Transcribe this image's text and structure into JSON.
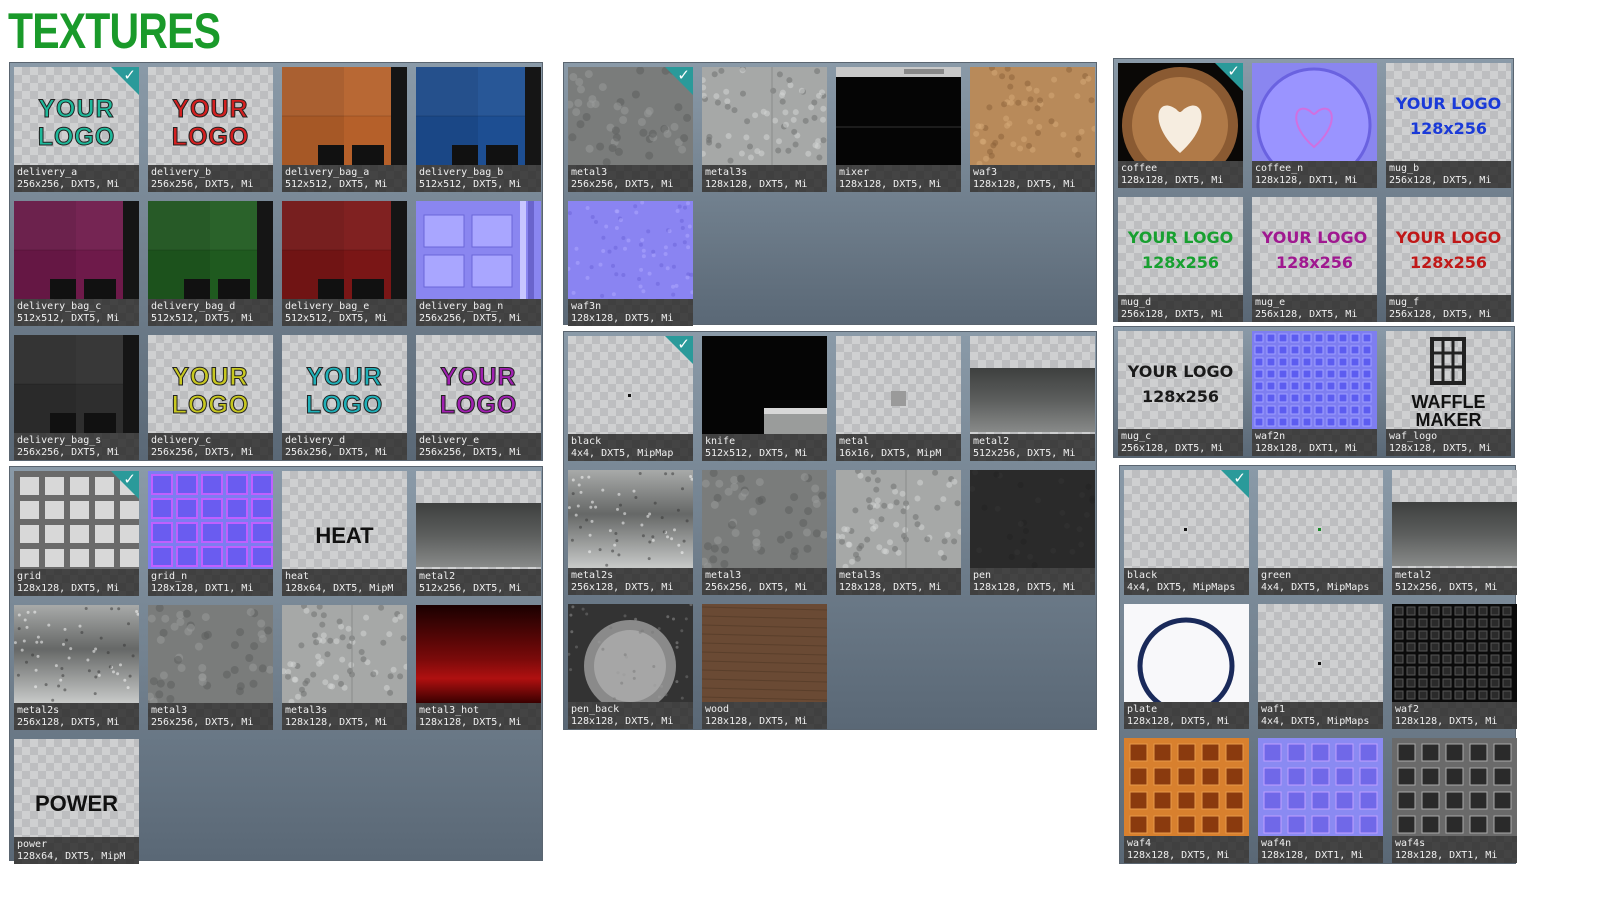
{
  "title": "TEXTURES",
  "logo_text": "YOUR LOGO",
  "logo_text_line1": "YOUR",
  "logo_text_line2": "LOGO",
  "logo_size_text": "128x256",
  "heat_text": "HEAT",
  "power_text": "POWER",
  "waffle_maker_text": "WAFFLE MAKER",
  "colors": {
    "title": "#1a9a2a",
    "selection": "#2a9a9a"
  },
  "panels": [
    {
      "id": "p1",
      "tiles": [
        {
          "name": "delivery_a",
          "info": "256x256, DXT5, Mi",
          "selected": true,
          "kind": "logo",
          "logo_color": "#1fb89a"
        },
        {
          "name": "delivery_b",
          "info": "256x256, DXT5, Mi",
          "kind": "logo",
          "logo_color": "#d42020"
        },
        {
          "name": "delivery_bag_a",
          "info": "512x512, DXT5, Mi",
          "kind": "bag",
          "color": "#b5602a"
        },
        {
          "name": "delivery_bag_b",
          "info": "512x512, DXT5, Mi",
          "kind": "bag",
          "color": "#1d4e92"
        },
        {
          "name": "delivery_bag_c",
          "info": "512x512, DXT5, Mi",
          "kind": "bag",
          "color": "#6e1a4a"
        },
        {
          "name": "delivery_bag_d",
          "info": "512x512, DXT5, Mi",
          "kind": "bag",
          "color": "#1f5a1f"
        },
        {
          "name": "delivery_bag_e",
          "info": "512x512, DXT5, Mi",
          "kind": "bag",
          "color": "#7a1616"
        },
        {
          "name": "delivery_bag_n",
          "info": "256x256, DXT5, Mi",
          "kind": "normal"
        },
        {
          "name": "delivery_bag_s",
          "info": "256x256, DXT5, Mi",
          "kind": "bag",
          "color": "#2e2e2e"
        },
        {
          "name": "delivery_c",
          "info": "256x256, DXT5, Mi",
          "kind": "logo",
          "logo_color": "#c8c820"
        },
        {
          "name": "delivery_d",
          "info": "256x256, DXT5, Mi",
          "kind": "logo",
          "logo_color": "#20b0b8"
        },
        {
          "name": "delivery_e",
          "info": "256x256, DXT5, Mi",
          "kind": "logo",
          "logo_color": "#a020b0"
        }
      ]
    },
    {
      "id": "p2",
      "tiles": [
        {
          "name": "grid",
          "info": "128x128, DXT5, Mi",
          "selected": true,
          "kind": "grid"
        },
        {
          "name": "grid_n",
          "info": "128x128, DXT1, Mi",
          "kind": "gridn"
        },
        {
          "name": "heat",
          "info": "128x64, DXT5, MipM",
          "kind": "heat"
        },
        {
          "name": "metal2",
          "info": "512x256, DXT5, Mi",
          "kind": "metal2"
        },
        {
          "name": "metal2s",
          "info": "256x128, DXT5, Mi",
          "kind": "metal2s"
        },
        {
          "name": "metal3",
          "info": "256x256, DXT5, Mi",
          "kind": "metal3"
        },
        {
          "name": "metal3s",
          "info": "128x128, DXT5, Mi",
          "kind": "metal3s"
        },
        {
          "name": "metal3_hot",
          "info": "128x128, DXT5, Mi",
          "kind": "hot"
        },
        {
          "name": "power",
          "info": "128x64, DXT5, MipM",
          "kind": "power"
        }
      ]
    },
    {
      "id": "p3",
      "tiles": [
        {
          "name": "metal3",
          "info": "256x256, DXT5, Mi",
          "selected": true,
          "kind": "metal3"
        },
        {
          "name": "metal3s",
          "info": "128x128, DXT5, Mi",
          "kind": "metal3s"
        },
        {
          "name": "mixer",
          "info": "128x128, DXT5, Mi",
          "kind": "mixer"
        },
        {
          "name": "waf3",
          "info": "128x128, DXT5, Mi",
          "kind": "sand"
        },
        {
          "name": "waf3n",
          "info": "128x128, DXT5, Mi",
          "kind": "bluenoise"
        }
      ]
    },
    {
      "id": "p4",
      "tiles": [
        {
          "name": "black",
          "info": "4x4, DXT5, MipMap",
          "selected": true,
          "kind": "dot"
        },
        {
          "name": "knife",
          "info": "512x512, DXT5, Mi",
          "kind": "knife"
        },
        {
          "name": "metal",
          "info": "16x16, DXT5, MipM",
          "kind": "square"
        },
        {
          "name": "metal2",
          "info": "512x256, DXT5, Mi",
          "kind": "metal2"
        },
        {
          "name": "metal2s",
          "info": "256x128, DXT5, Mi",
          "kind": "metal2s"
        },
        {
          "name": "metal3",
          "info": "256x256, DXT5, Mi",
          "kind": "metal3"
        },
        {
          "name": "metal3s",
          "info": "128x128, DXT5, Mi",
          "kind": "metal3s"
        },
        {
          "name": "pen",
          "info": "128x128, DXT5, Mi",
          "kind": "pen"
        },
        {
          "name": "pen_back",
          "info": "128x128, DXT5, Mi",
          "kind": "penback"
        },
        {
          "name": "wood",
          "info": "128x128, DXT5, Mi",
          "kind": "wood"
        }
      ]
    },
    {
      "id": "p5",
      "tiles": [
        {
          "name": "coffee",
          "info": "128x128, DXT5, Mi",
          "selected": true,
          "kind": "coffee"
        },
        {
          "name": "coffee_n",
          "info": "128x128, DXT1, Mi",
          "kind": "coffeen"
        },
        {
          "name": "mug_b",
          "info": "256x128, DXT5, Mi",
          "kind": "logo2",
          "logo_color": "#1a3ad8"
        },
        {
          "name": "mug_d",
          "info": "256x128, DXT5, Mi",
          "kind": "logo2",
          "logo_color": "#18a030"
        },
        {
          "name": "mug_e",
          "info": "256x128, DXT5, Mi",
          "kind": "logo2",
          "logo_color": "#a01890"
        },
        {
          "name": "mug_f",
          "info": "256x128, DXT5, Mi",
          "kind": "logo2",
          "logo_color": "#c01818"
        }
      ]
    },
    {
      "id": "p6",
      "tiles": [
        {
          "name": "mug_c",
          "info": "256x128, DXT5, Mi",
          "kind": "logo2",
          "logo_color": "#1a1a1a"
        },
        {
          "name": "waf2n",
          "info": "128x128, DXT1, Mi",
          "kind": "waf2n"
        },
        {
          "name": "waf_logo",
          "info": "128x128, DXT5, Mi",
          "kind": "waflogo"
        }
      ]
    },
    {
      "id": "p7",
      "tiles": [
        {
          "name": "black",
          "info": "4x4, DXT5, MipMaps",
          "selected": true,
          "kind": "dot"
        },
        {
          "name": "green",
          "info": "4x4, DXT5, MipMaps",
          "kind": "greendot"
        },
        {
          "name": "metal2",
          "info": "512x256, DXT5, Mi",
          "kind": "metal2"
        },
        {
          "name": "plate",
          "info": "128x128, DXT5, Mi",
          "kind": "plate"
        },
        {
          "name": "waf1",
          "info": "4x4, DXT5, MipMaps",
          "kind": "dot"
        },
        {
          "name": "waf2",
          "info": "128x128, DXT5, Mi",
          "kind": "waf2"
        },
        {
          "name": "waf4",
          "info": "128x128, DXT5, Mi",
          "kind": "waf4"
        },
        {
          "name": "waf4n",
          "info": "128x128, DXT1, Mi",
          "kind": "waf4n"
        },
        {
          "name": "waf4s",
          "info": "128x128, DXT1, Mi",
          "kind": "waf4s"
        }
      ]
    }
  ]
}
